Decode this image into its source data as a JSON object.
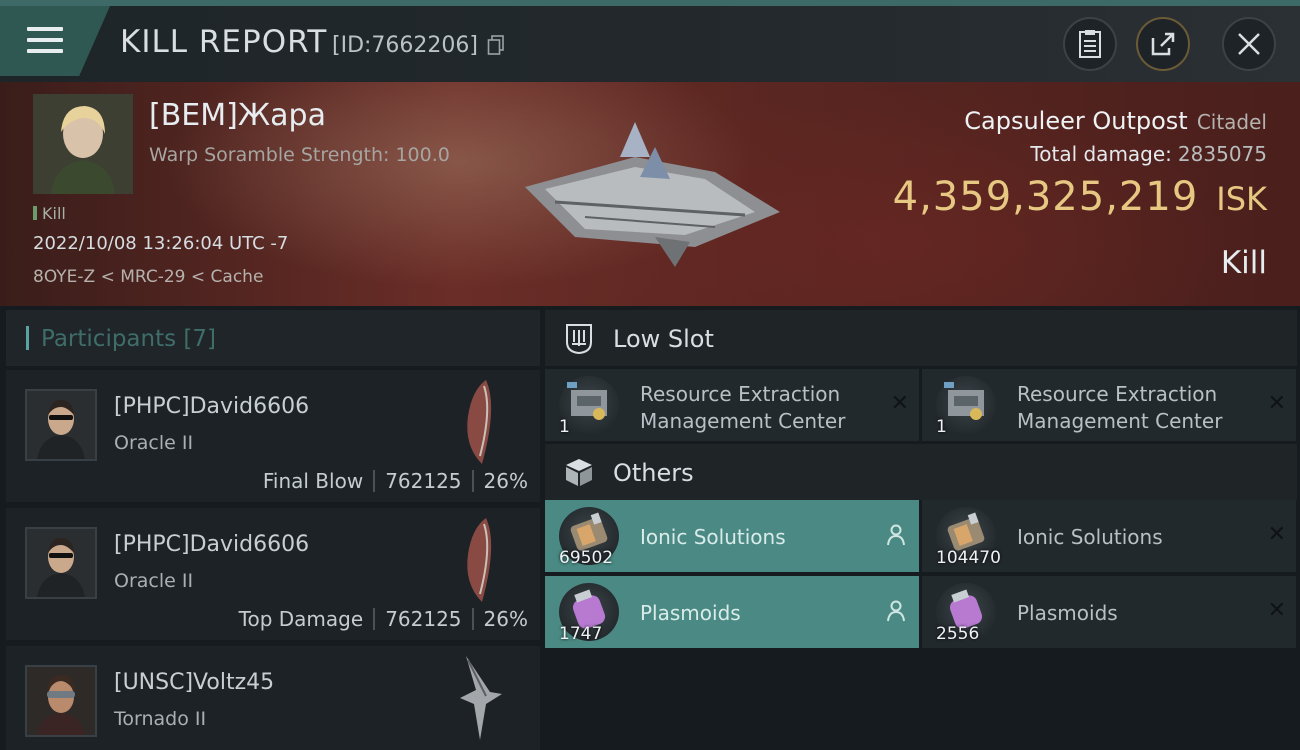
{
  "header": {
    "title": "KILL REPORT",
    "report_id": "[ID:7662206]",
    "buttons": [
      "clipboard-icon",
      "share-icon",
      "close-icon"
    ]
  },
  "victim": {
    "name": "[BEM]Жара",
    "scramble": "Warp Soramble Strength: 100.0",
    "tag": "Kill",
    "datetime": "2022/10/08 13:26:04 UTC -7",
    "location": "8OYE-Z < MRC-29 < Cache"
  },
  "target": {
    "name": "Capsuleer Outpost",
    "type": "Citadel",
    "damage_label": "Total damage:",
    "damage_value": "2835075",
    "isk_value": "4,359,325,219",
    "isk_unit": "ISK",
    "result": "Kill"
  },
  "participants": {
    "header": "Participants [7]",
    "rows": [
      {
        "name": "[PHPC]David6606",
        "ship": "Oracle II",
        "role": "Final Blow",
        "damage": "762125",
        "percent": "26%"
      },
      {
        "name": "[PHPC]David6606",
        "ship": "Oracle II",
        "role": "Top Damage",
        "damage": "762125",
        "percent": "26%"
      },
      {
        "name": "[UNSC]Voltz45",
        "ship": "Tornado II"
      }
    ]
  },
  "low_slot": {
    "title": "Low Slot",
    "items": [
      {
        "name": "Resource Extraction Management Center",
        "qty": "1"
      },
      {
        "name": "Resource Extraction Management Center",
        "qty": "1"
      }
    ]
  },
  "others": {
    "title": "Others",
    "items": [
      {
        "name": "Ionic Solutions",
        "qty": "69502",
        "dropped": true
      },
      {
        "name": "Ionic Solutions",
        "qty": "104470",
        "dropped": false
      },
      {
        "name": "Plasmoids",
        "qty": "1747",
        "dropped": true
      },
      {
        "name": "Plasmoids",
        "qty": "2556",
        "dropped": false
      }
    ]
  },
  "colors": {
    "accent_teal": "#4b8a84",
    "isk_gold": "#e7c883",
    "hero_red": "#6b2d27"
  }
}
